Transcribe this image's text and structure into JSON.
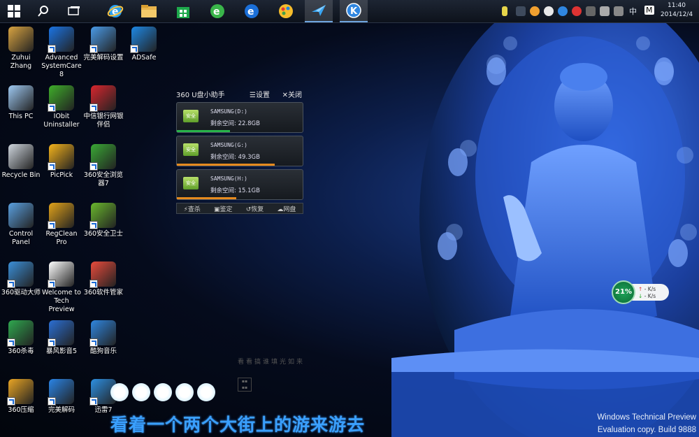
{
  "taskbar": {
    "pinned": [
      "start-icon",
      "search-icon",
      "task-view-icon",
      "ie-icon",
      "file-explorer-icon",
      "store-icon",
      "browser-360-icon",
      "ie-alt-icon",
      "picpick-icon",
      "xunlei-icon",
      "kugou-icon"
    ],
    "tray": {
      "ime": "中",
      "m": "M"
    },
    "clock": {
      "time": "11:40",
      "date": "2014/12/4"
    }
  },
  "desktop_icons": [
    {
      "label": "Zuhui Zhang",
      "icon": "user-folder-icon",
      "color": "#d9a441"
    },
    {
      "label": "Advanced SystemCare 8",
      "icon": "systemcare-icon",
      "color": "#1b74e4"
    },
    {
      "label": "完美解码设置",
      "icon": "settings-gear-icon",
      "color": "#4a9be8"
    },
    {
      "label": "ADSafe",
      "icon": "adsafe-icon",
      "color": "#1e88e5"
    },
    {
      "label": "This PC",
      "icon": "this-pc-icon",
      "color": "#9ec9f2"
    },
    {
      "label": "IObit Uninstaller",
      "icon": "iobit-uninstaller-icon",
      "color": "#3fae2a"
    },
    {
      "label": "中信银行网银伴侣",
      "icon": "citic-bank-icon",
      "color": "#d8262e"
    },
    {
      "label": "Recycle Bin",
      "icon": "recycle-bin-icon",
      "color": "#cfd6de"
    },
    {
      "label": "PicPick",
      "icon": "picpick-icon",
      "color": "#f5b31b"
    },
    {
      "label": "360安全浏览器7",
      "icon": "browser-360-icon",
      "color": "#3aa935"
    },
    {
      "label": "Control Panel",
      "icon": "control-panel-icon",
      "color": "#5aa0e0"
    },
    {
      "label": "RegClean Pro",
      "icon": "regclean-icon",
      "color": "#e2a31a"
    },
    {
      "label": "360安全卫士",
      "icon": "security-360-icon",
      "color": "#6ab82d"
    },
    {
      "label": "360驱动大师",
      "icon": "driver-master-icon",
      "color": "#3b8fd8"
    },
    {
      "label": "Welcome to Tech Preview",
      "icon": "windows-logo-icon",
      "color": "#ffffff"
    },
    {
      "label": "360软件管家",
      "icon": "software-manager-icon",
      "color": "#e94b3c"
    },
    {
      "label": "360杀毒",
      "icon": "antivirus-360-icon",
      "color": "#2fa84f"
    },
    {
      "label": "暴风影音5",
      "icon": "storm-player-icon",
      "color": "#2b6fd4"
    },
    {
      "label": "酷狗音乐",
      "icon": "kugou-icon",
      "color": "#2f86e0"
    },
    {
      "label": "360压缩",
      "icon": "zip-360-icon",
      "color": "#e9a524"
    },
    {
      "label": "完美解码",
      "icon": "perfect-decoder-icon",
      "color": "#2a84e6"
    },
    {
      "label": "迅雷7",
      "icon": "xunlei-icon",
      "color": "#2d8fe2"
    }
  ],
  "usb_widget": {
    "title": "360 U盘小助手",
    "settings": "设置",
    "close": "关闭",
    "drives": [
      {
        "name": "SAMSUNG(D:)",
        "free": "剩余空间: 22.8GB",
        "badge": "安全",
        "bar_color": "#27b34a",
        "fill": 0.42
      },
      {
        "name": "SAMSUNG(G:)",
        "free": "剩余空间: 49.3GB",
        "badge": "安全",
        "bar_color": "#e58a1e",
        "fill": 0.78
      },
      {
        "name": "SAMSUNG(H:)",
        "free": "剩余空间: 15.1GB",
        "badge": "安全",
        "bar_color": "#e58a1e",
        "fill": 0.47
      }
    ],
    "footer": [
      "查杀",
      "鉴定",
      "恢复",
      "网盘"
    ]
  },
  "net_meter": {
    "percent": "21%",
    "up": "- K/s",
    "down": "- K/s"
  },
  "lyric": "看着一个两个大街上的游来游去",
  "faint_text": "看看搞谁填光如来",
  "watermark": {
    "line1": "Windows Technical Preview",
    "line2": "Evaluation copy. Build 9888"
  }
}
